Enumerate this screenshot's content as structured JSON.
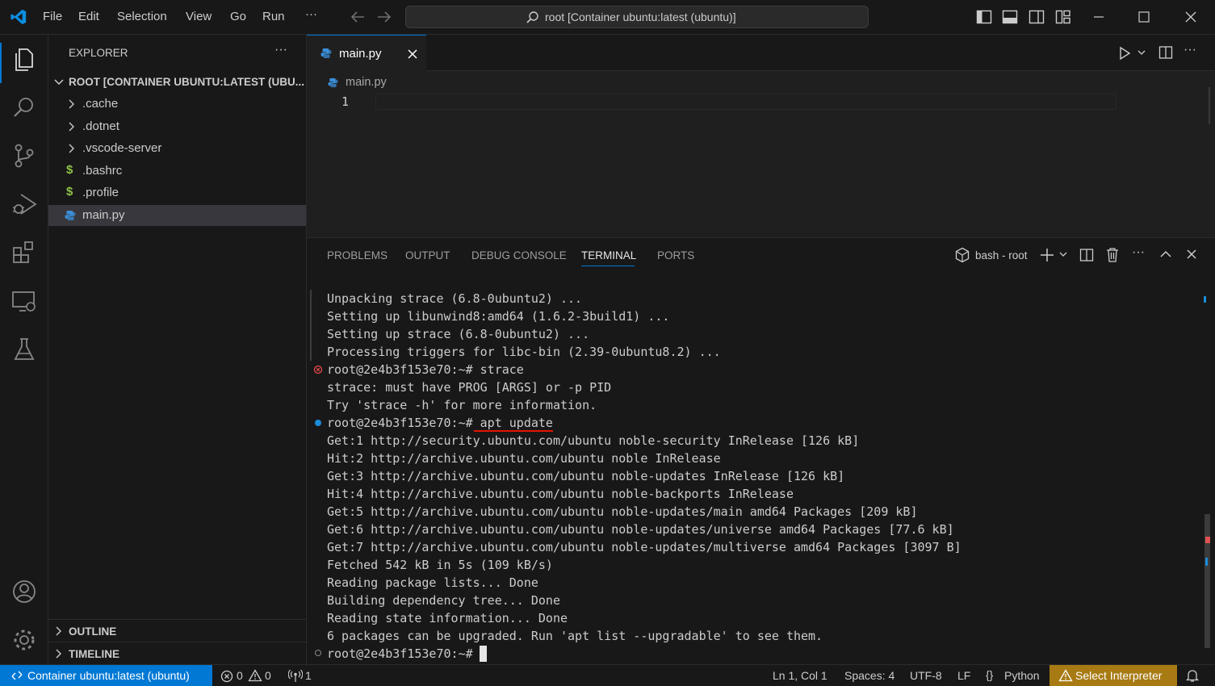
{
  "titlebar": {
    "menu": [
      "File",
      "Edit",
      "Selection",
      "View",
      "Go",
      "Run",
      "···"
    ],
    "search_text": "root [Container ubuntu:latest (ubuntu)]"
  },
  "activity_bar": {
    "icons": [
      "explorer-icon",
      "search-icon",
      "source-control-icon",
      "run-debug-icon",
      "extensions-icon",
      "remote-explorer-icon",
      "testing-icon",
      "accounts-icon",
      "settings-gear-icon"
    ]
  },
  "sidebar": {
    "header": "EXPLORER",
    "more": "···",
    "root_label": "ROOT [CONTAINER UBUNTU:LATEST (UBU...",
    "items": [
      {
        "label": ".cache",
        "kind": "folder"
      },
      {
        "label": ".dotnet",
        "kind": "folder"
      },
      {
        "label": ".vscode-server",
        "kind": "folder"
      },
      {
        "label": ".bashrc",
        "kind": "shell"
      },
      {
        "label": ".profile",
        "kind": "shell"
      },
      {
        "label": "main.py",
        "kind": "python",
        "selected": true
      }
    ],
    "outline": "OUTLINE",
    "timeline": "TIMELINE"
  },
  "editor": {
    "tab_label": "main.py",
    "breadcrumb": "main.py",
    "line_number": "1"
  },
  "panel": {
    "tabs": [
      "PROBLEMS",
      "OUTPUT",
      "DEBUG CONSOLE",
      "TERMINAL",
      "PORTS"
    ],
    "active_tab": "TERMINAL",
    "terminal_name": "bash - root",
    "lines": [
      "Unpacking strace (6.8-0ubuntu2) ...",
      "Setting up libunwind8:amd64 (1.6.2-3build1) ...",
      "Setting up strace (6.8-0ubuntu2) ...",
      "Processing triggers for libc-bin (2.39-0ubuntu8.2) ...",
      "root@2e4b3f153e70:~# strace",
      "strace: must have PROG [ARGS] or -p PID",
      "Try 'strace -h' for more information.",
      "root@2e4b3f153e70:~# apt update",
      "Get:1 http://security.ubuntu.com/ubuntu noble-security InRelease [126 kB]",
      "Hit:2 http://archive.ubuntu.com/ubuntu noble InRelease",
      "Get:3 http://archive.ubuntu.com/ubuntu noble-updates InRelease [126 kB]",
      "Hit:4 http://archive.ubuntu.com/ubuntu noble-backports InRelease",
      "Get:5 http://archive.ubuntu.com/ubuntu noble-updates/main amd64 Packages [209 kB]",
      "Get:6 http://archive.ubuntu.com/ubuntu noble-updates/universe amd64 Packages [77.6 kB]",
      "Get:7 http://archive.ubuntu.com/ubuntu noble-updates/multiverse amd64 Packages [3097 B]",
      "Fetched 542 kB in 5s (109 kB/s)",
      "Reading package lists... Done",
      "Building dependency tree... Done",
      "Reading state information... Done",
      "6 packages can be upgraded. Run 'apt list --upgradable' to see them.",
      "root@2e4b3f153e70:~# "
    ]
  },
  "statusbar": {
    "remote": "Container ubuntu:latest (ubuntu)",
    "errors": "0",
    "warnings": "0",
    "ports": "1",
    "position": "Ln 1, Col 1",
    "spaces": "Spaces: 4",
    "encoding": "UTF-8",
    "eol": "LF",
    "language": "Python",
    "interpreter": "Select Interpreter"
  },
  "colors": {
    "accent": "#0078d4",
    "remote_bg": "#0078d4",
    "interpreter_bg": "#a77a13",
    "error": "#f14c4c",
    "annotation_red": "#e51400"
  }
}
